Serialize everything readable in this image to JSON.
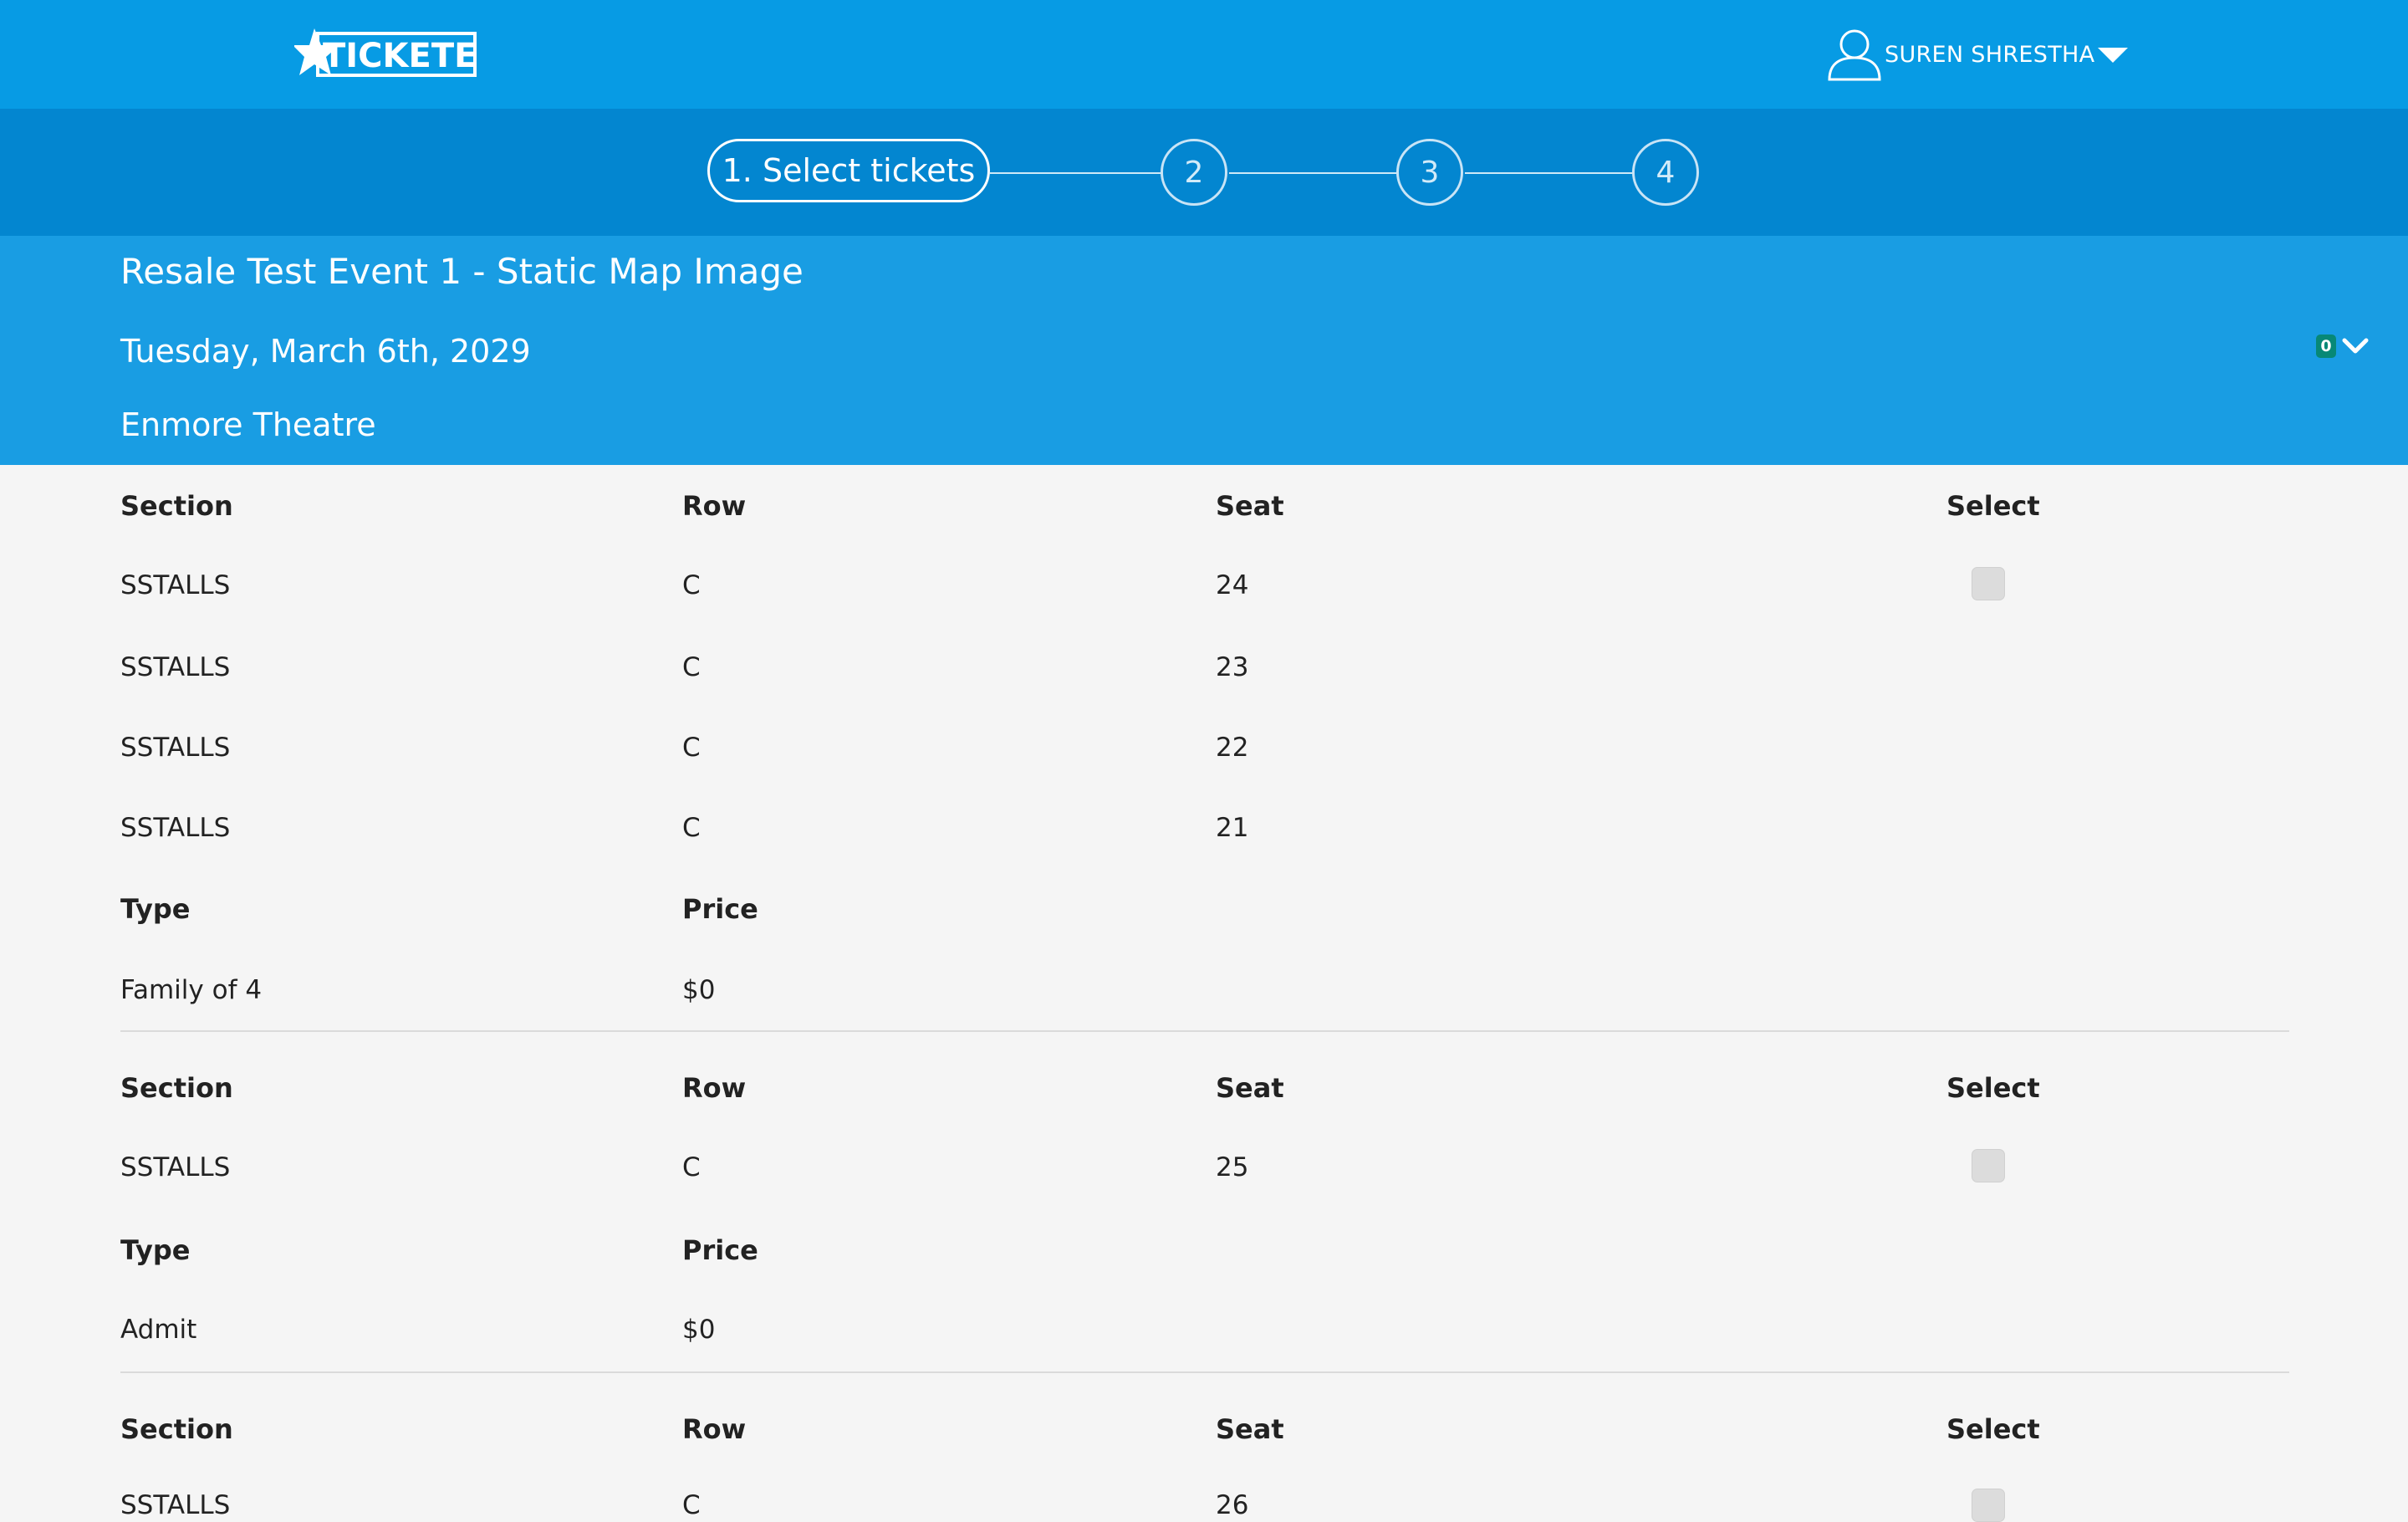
{
  "brand": {
    "logo_text": "TICKETEK"
  },
  "user": {
    "name": "SUREN SHRESTHA"
  },
  "stepper": {
    "active_label": "1. Select tickets",
    "steps": [
      "2",
      "3",
      "4"
    ]
  },
  "event": {
    "title": "Resale Test Event 1 - Static Map Image",
    "date": "Tuesday, March 6th, 2029",
    "venue": "Enmore Theatre",
    "cart_count": "0"
  },
  "columns": {
    "section": "Section",
    "row": "Row",
    "seat": "Seat",
    "select": "Select",
    "type": "Type",
    "price": "Price"
  },
  "listings": [
    {
      "seats": [
        {
          "section": "SSTALLS",
          "row": "C",
          "seat": "24"
        },
        {
          "section": "SSTALLS",
          "row": "C",
          "seat": "23"
        },
        {
          "section": "SSTALLS",
          "row": "C",
          "seat": "22"
        },
        {
          "section": "SSTALLS",
          "row": "C",
          "seat": "21"
        }
      ],
      "type": "Family of 4",
      "price": "$0"
    },
    {
      "seats": [
        {
          "section": "SSTALLS",
          "row": "C",
          "seat": "25"
        }
      ],
      "type": "Admit",
      "price": "$0"
    },
    {
      "seats": [
        {
          "section": "SSTALLS",
          "row": "C",
          "seat": "26"
        }
      ]
    }
  ]
}
